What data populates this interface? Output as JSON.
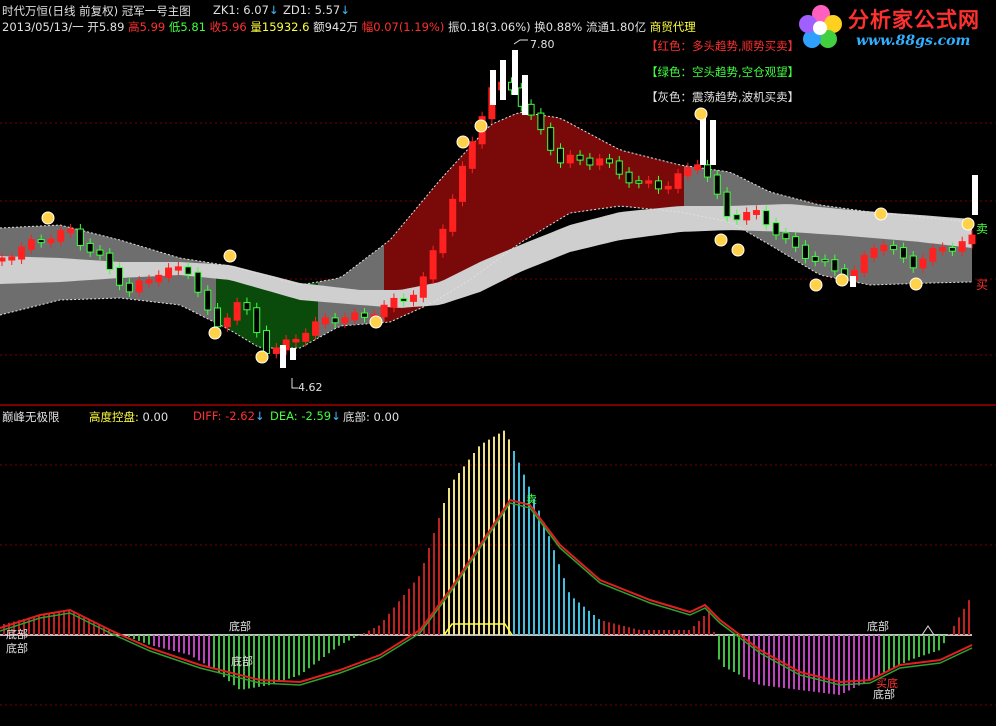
{
  "header": {
    "title": "时代万恒(日线 前复权) 冠军一号主图",
    "zk1_label": "ZK1:",
    "zk1_value": "6.07",
    "zd1_label": "ZD1:",
    "zd1_value": "5.57",
    "date": "2013/05/13/一",
    "open_label": "开",
    "open": "5.89",
    "high_label": "高",
    "high": "5.99",
    "low_label": "低",
    "low": "5.81",
    "close_label": "收",
    "close": "5.96",
    "vol_label": "量",
    "vol": "15932.6",
    "amt_label": "额",
    "amt": "942万",
    "chg_label": "幅",
    "chg": "0.07(1.19%)",
    "amp_label": "振",
    "amp": "0.18(3.06%)",
    "turn_label": "换",
    "turn": "0.88%",
    "float_label": "流通",
    "float": "1.80亿",
    "sector": "商贸代理"
  },
  "legend": {
    "red": "【红色：多头趋势,顺势买卖】",
    "green": "【绿色：空头趋势,空仓观望】",
    "gray": "【灰色：震荡趋势,波机买卖】"
  },
  "logo": {
    "title": "分析家公式网",
    "url": "www.88gs.com"
  },
  "price": {
    "high_mark": "7.80",
    "low_mark": "4.62",
    "sell_mark": "卖",
    "buy_mark": "买"
  },
  "indicator": {
    "name": "巅峰无极限",
    "ctrl_label": "高度控盘:",
    "ctrl_value": "0.00",
    "diff_label": "DIFF:",
    "diff_value": "-2.62",
    "dea_label": "DEA:",
    "dea_value": "-2.59",
    "bottom_label": "底部:",
    "bottom_value": "0.00",
    "ann_bottom": "底部",
    "ann_sell": "卖",
    "ann_buy_bottom": "买底"
  },
  "colors": {
    "up": "#ff2020",
    "down": "#40ff40",
    "red_band": "#7a0a0a",
    "green_band": "#0a4a0a",
    "gray_band": "#6e6e6e",
    "light_band": "#cfcfcf"
  }
}
